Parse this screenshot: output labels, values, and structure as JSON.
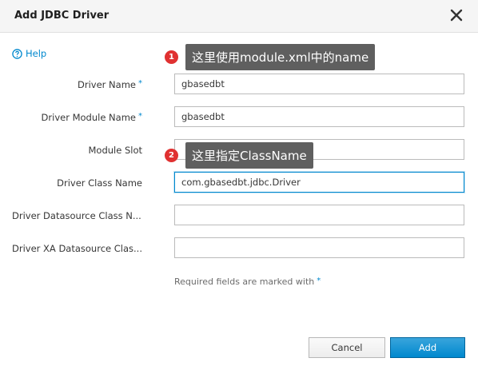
{
  "dialog": {
    "title": "Add JDBC Driver",
    "close_icon": "close-icon"
  },
  "help": {
    "label": "Help",
    "icon": "help-circle-icon"
  },
  "fields": [
    {
      "label": "Driver Name",
      "required": true,
      "value": "gbasedbt"
    },
    {
      "label": "Driver Module Name",
      "required": true,
      "value": "gbasedbt"
    },
    {
      "label": "Module Slot",
      "required": false,
      "value": ""
    },
    {
      "label": "Driver Class Name",
      "required": false,
      "value": "com.gbasedbt.jdbc.Driver"
    },
    {
      "label": "Driver Datasource Class N...",
      "required": false,
      "value": ""
    },
    {
      "label": "Driver XA Datasource Clas...",
      "required": false,
      "value": ""
    }
  ],
  "required_marker": "*",
  "note": "Required fields are marked with",
  "buttons": {
    "cancel": "Cancel",
    "add": "Add"
  },
  "callouts": [
    {
      "number": "1",
      "text": "这里使用module.xml中的name"
    },
    {
      "number": "2",
      "text": "这里指定ClassName"
    }
  ],
  "colors": {
    "accent": "#0088ce",
    "badge": "#e03131",
    "tooltip": "#5f5f5f"
  }
}
